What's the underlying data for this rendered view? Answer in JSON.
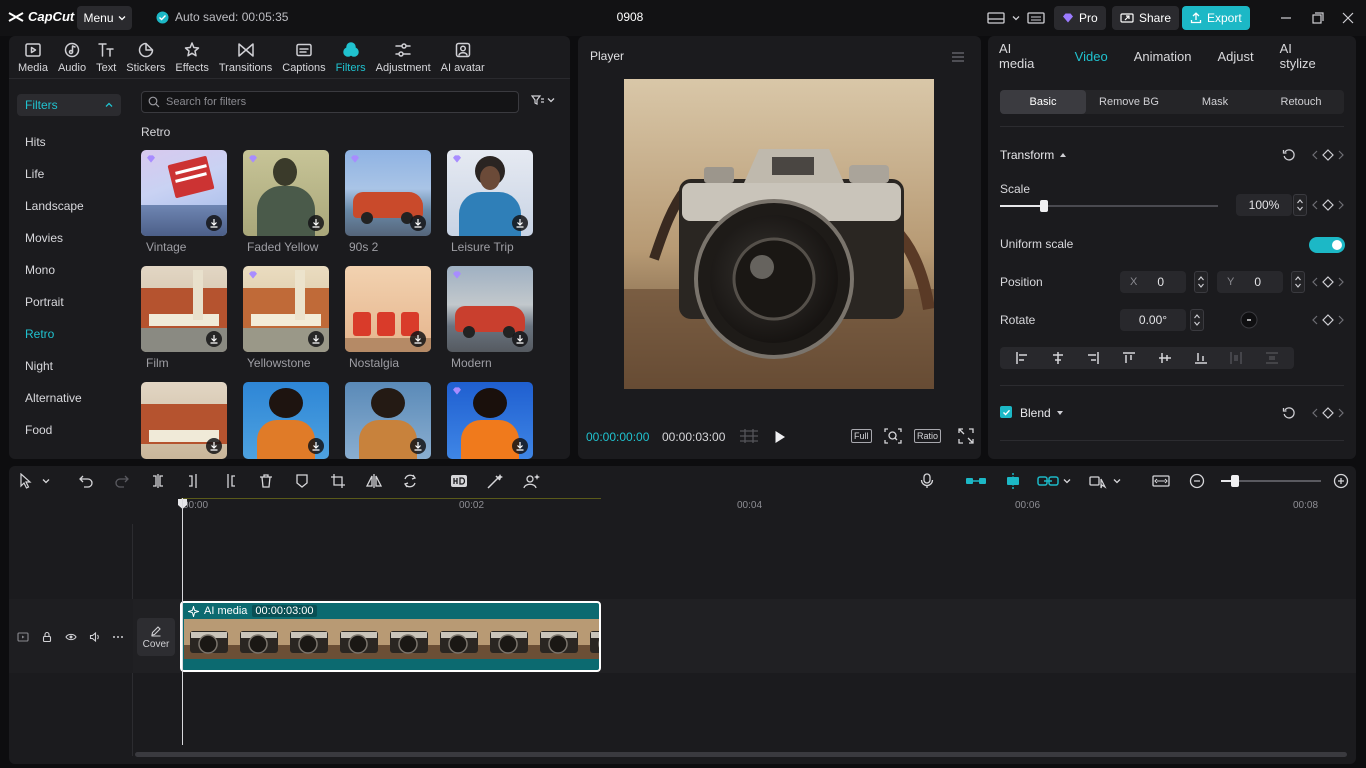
{
  "titlebar": {
    "app_name": "CapCut",
    "menu_label": "Menu",
    "autosave_text": "Auto saved: 00:05:35",
    "project_title": "0908",
    "pro_label": "Pro",
    "share_label": "Share",
    "export_label": "Export"
  },
  "toolbar": {
    "tabs": [
      {
        "label": "Media",
        "icon": "media-icon"
      },
      {
        "label": "Audio",
        "icon": "audio-icon"
      },
      {
        "label": "Text",
        "icon": "text-icon"
      },
      {
        "label": "Stickers",
        "icon": "stickers-icon"
      },
      {
        "label": "Effects",
        "icon": "effects-icon"
      },
      {
        "label": "Transitions",
        "icon": "transitions-icon"
      },
      {
        "label": "Captions",
        "icon": "captions-icon"
      },
      {
        "label": "Filters",
        "icon": "filters-icon",
        "active": true
      },
      {
        "label": "Adjustment",
        "icon": "adjustment-icon"
      },
      {
        "label": "AI avatar",
        "icon": "ai-avatar-icon"
      }
    ]
  },
  "filters": {
    "header": "Filters",
    "categories": [
      "Hits",
      "Life",
      "Landscape",
      "Movies",
      "Mono",
      "Portrait",
      "Retro",
      "Night",
      "Alternative",
      "Food"
    ],
    "active_category": "Retro",
    "search_placeholder": "Search for filters",
    "section_label": "Retro",
    "items": [
      {
        "label": "Vintage"
      },
      {
        "label": "Faded Yellow"
      },
      {
        "label": "90s 2"
      },
      {
        "label": "Leisure Trip"
      },
      {
        "label": "Film"
      },
      {
        "label": "Yellowstone"
      },
      {
        "label": "Nostalgia"
      },
      {
        "label": "Modern"
      },
      {
        "label": ""
      },
      {
        "label": ""
      },
      {
        "label": ""
      },
      {
        "label": ""
      }
    ]
  },
  "player": {
    "title": "Player",
    "current_time": "00:00:00:00",
    "total_time": "00:00:03:00",
    "full_label": "Full",
    "ratio_label": "Ratio"
  },
  "inspector": {
    "tabs": [
      "AI media",
      "Video",
      "Animation",
      "Adjust",
      "AI stylize"
    ],
    "active_tab": "Video",
    "subtabs": [
      "Basic",
      "Remove BG",
      "Mask",
      "Retouch"
    ],
    "active_subtab": "Basic",
    "transform_label": "Transform",
    "scale_label": "Scale",
    "scale_value": "100%",
    "scale_fraction": 0.2,
    "uniform_scale_label": "Uniform scale",
    "uniform_scale_on": true,
    "position_label": "Position",
    "pos_x_label": "X",
    "pos_x": "0",
    "pos_y_label": "Y",
    "pos_y": "0",
    "rotate_label": "Rotate",
    "rotate_value": "0.00°",
    "blend_label": "Blend",
    "blend_checked": true
  },
  "timeline": {
    "ruler": [
      "00:00",
      "00:02",
      "00:04",
      "00:06",
      "00:08"
    ],
    "clip_label": "AI media",
    "clip_duration": "00:00:03:00",
    "cover_label": "Cover"
  },
  "colors": {
    "accent": "#1cb8c6",
    "panel_bg": "#1b1b1e",
    "app_bg": "#0d0d0f"
  }
}
